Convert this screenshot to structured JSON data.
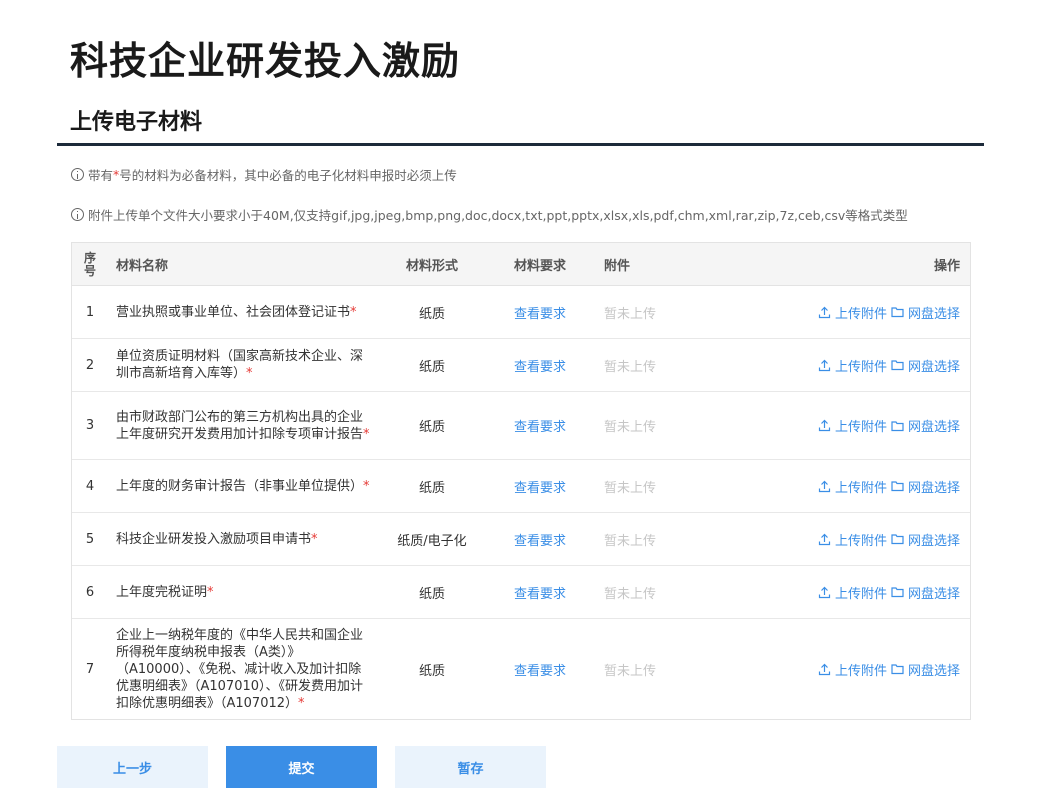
{
  "page": {
    "title": "科技企业研发投入激励",
    "section_title": "上传电子材料"
  },
  "notices": {
    "notice1_prefix": "带有",
    "notice1_star": "*",
    "notice1_suffix": "号的材料为必备材料，其中必备的电子化材料申报时必须上传",
    "notice2": "附件上传单个文件大小要求小于40M,仅支持gif,jpg,jpeg,bmp,png,doc,docx,txt,ppt,pptx,xlsx,xls,pdf,chm,xml,rar,zip,7z,ceb,csv等格式类型"
  },
  "table": {
    "headers": {
      "no": "序号",
      "name": "材料名称",
      "form": "材料形式",
      "requirement": "材料要求",
      "attachment": "附件",
      "action": "操作"
    },
    "rows": [
      {
        "no": "1",
        "name": "营业执照或事业单位、社会团体登记证书",
        "required_mark": "*",
        "form": "纸质",
        "requirement": "查看要求",
        "attachment": "暂未上传",
        "upload": "上传附件",
        "netdisk": "网盘选择"
      },
      {
        "no": "2",
        "name": "单位资质证明材料（国家高新技术企业、深圳市高新培育入库等）",
        "required_mark": "*",
        "form": "纸质",
        "requirement": "查看要求",
        "attachment": "暂未上传",
        "upload": "上传附件",
        "netdisk": "网盘选择"
      },
      {
        "no": "3",
        "name": "由市财政部门公布的第三方机构出具的企业上年度研究开发费用加计扣除专项审计报告",
        "required_mark": "*",
        "form": "纸质",
        "requirement": "查看要求",
        "attachment": "暂未上传",
        "upload": "上传附件",
        "netdisk": "网盘选择"
      },
      {
        "no": "4",
        "name": "上年度的财务审计报告（非事业单位提供）",
        "required_mark": "*",
        "form": "纸质",
        "requirement": "查看要求",
        "attachment": "暂未上传",
        "upload": "上传附件",
        "netdisk": "网盘选择"
      },
      {
        "no": "5",
        "name": "科技企业研发投入激励项目申请书",
        "required_mark": "*",
        "form": "纸质/电子化",
        "requirement": "查看要求",
        "attachment": "暂未上传",
        "upload": "上传附件",
        "netdisk": "网盘选择"
      },
      {
        "no": "6",
        "name": "上年度完税证明",
        "required_mark": "*",
        "form": "纸质",
        "requirement": "查看要求",
        "attachment": "暂未上传",
        "upload": "上传附件",
        "netdisk": "网盘选择"
      },
      {
        "no": "7",
        "name": "企业上一纳税年度的《中华人民共和国企业所得税年度纳税申报表（A类）》（A10000）、《免税、减计收入及加计扣除优惠明细表》（A107010）、《研发费用加计扣除优惠明细表》（A107012）",
        "required_mark": "*",
        "form": "纸质",
        "requirement": "查看要求",
        "attachment": "暂未上传",
        "upload": "上传附件",
        "netdisk": "网盘选择"
      }
    ]
  },
  "buttons": {
    "prev": "上一步",
    "submit": "提交",
    "save": "暂存"
  },
  "colors": {
    "accent": "#3a8ee6",
    "required": "#e53935",
    "muted": "#c6c6c6"
  }
}
